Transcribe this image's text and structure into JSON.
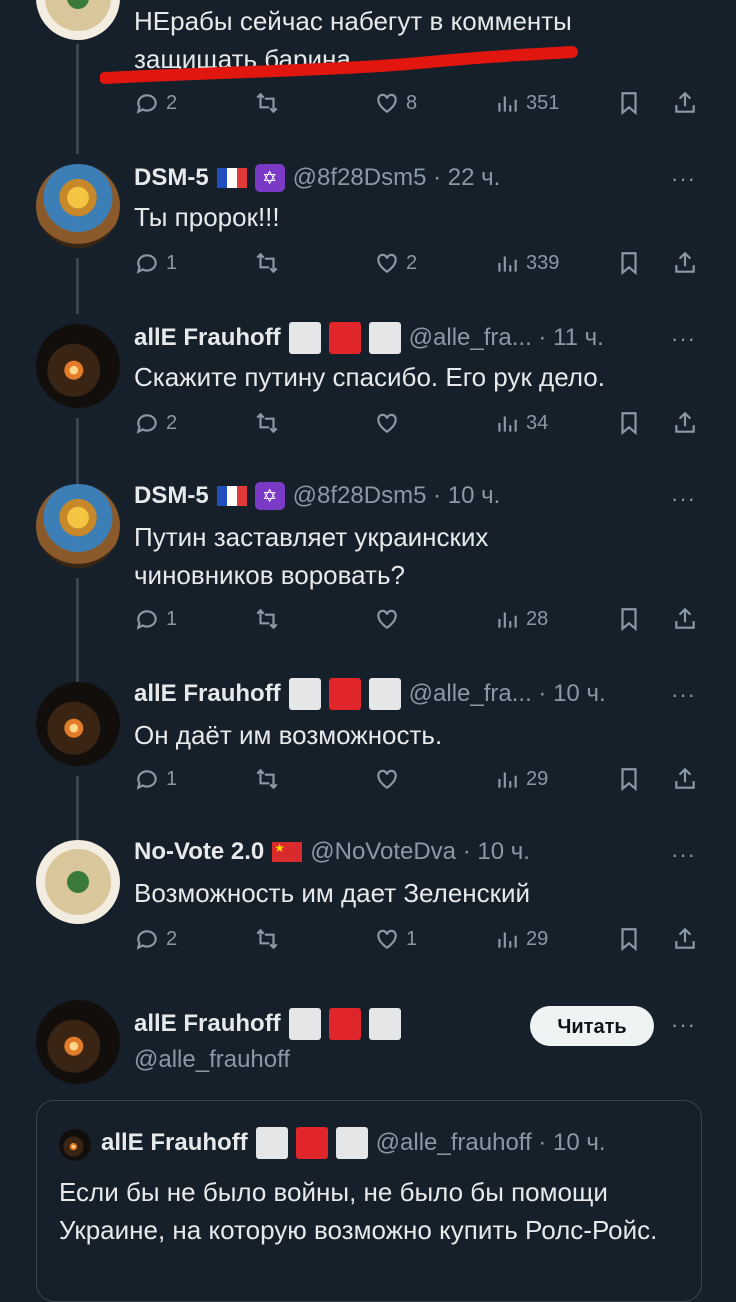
{
  "tweets": [
    {
      "name": "",
      "handle": "",
      "text": "НЕрабы сейчас набегут в комменты защищать барина",
      "replies": "2",
      "retweets": "",
      "likes": "8",
      "views": "351"
    },
    {
      "name": "DSM-5",
      "handle": "@8f28Dsm5 · 22 ч.",
      "text": "Ты пророк!!!",
      "replies": "1",
      "retweets": "",
      "likes": "2",
      "views": "339",
      "badges": [
        "flag-fr",
        "star-of-david"
      ]
    },
    {
      "name": "allE Frauhoff",
      "handle": "@alle_fra... · 11 ч.",
      "text": "Скажите путину спасибо. Его рук дело.",
      "replies": "2",
      "retweets": "",
      "likes": "",
      "views": "34"
    },
    {
      "name": "DSM-5",
      "handle": "@8f28Dsm5 · 10 ч.",
      "text": "Путин заставляет украинских чиновников воровать?",
      "replies": "1",
      "retweets": "",
      "likes": "",
      "views": "28",
      "badges": [
        "flag-fr",
        "star-of-david"
      ]
    },
    {
      "name": "allE Frauhoff",
      "handle": "@alle_fra... · 10 ч.",
      "text": "Он даёт им возможность.",
      "replies": "1",
      "retweets": "",
      "likes": "",
      "views": "29"
    },
    {
      "name": "No-Vote 2.0",
      "handle": "@NoVoteDva · 10 ч.",
      "text": "Возможность им дает Зеленский",
      "replies": "2",
      "retweets": "",
      "likes": "1",
      "views": "29",
      "badges": [
        "flag-cn"
      ]
    }
  ],
  "profile_card": {
    "name": "allE Frauhoff",
    "handle": "@alle_frauhoff",
    "follow_label": "Читать"
  },
  "quoted": {
    "name": "allE Frauhoff",
    "handle": "@alle_frauhoff · 10 ч.",
    "text": "Если бы не было войны, не было бы помощи Украине, на которую возможно купить Ролс-Ройс."
  },
  "more_label": "···",
  "colors": {
    "background": "#15202b",
    "muted": "#8b98a5",
    "annotation": "#e0160f"
  }
}
